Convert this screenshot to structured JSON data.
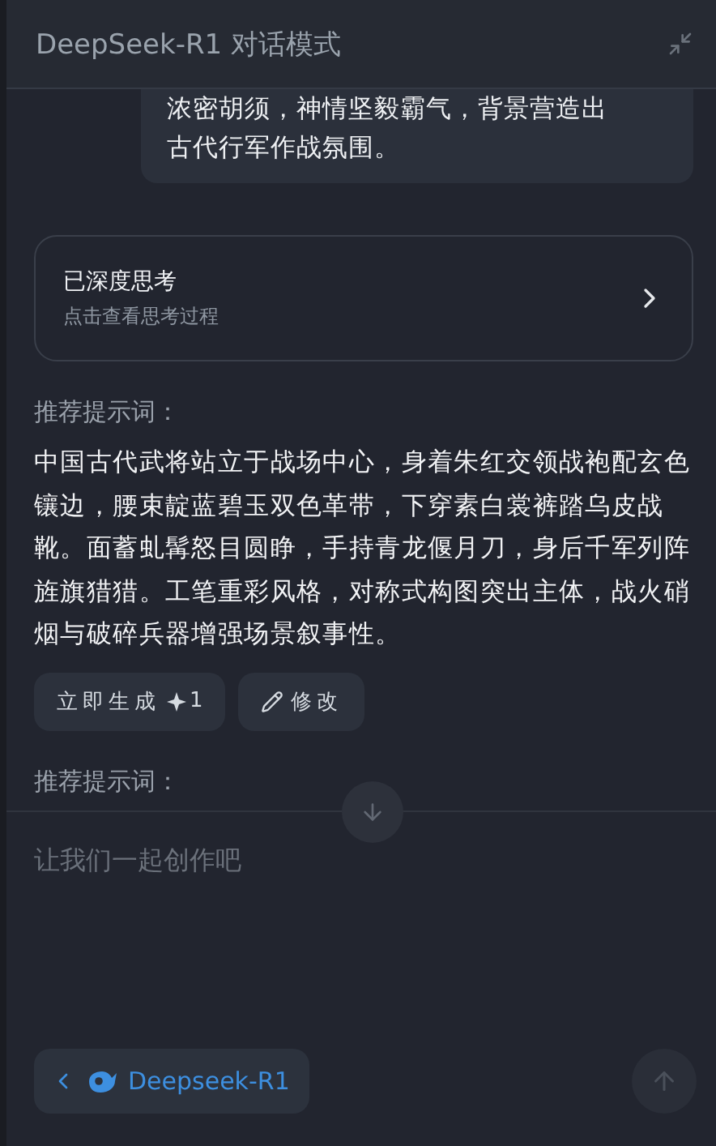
{
  "header": {
    "title": "DeepSeek-R1 对话模式"
  },
  "message": {
    "lines": [
      "浓密胡须，神情坚毅霸气，背景营造出",
      "古代行军作战氛围。"
    ]
  },
  "thinking_card": {
    "title": "已深度思考",
    "subtitle": "点击查看思考过程"
  },
  "suggestion": {
    "label": "推荐提示词：",
    "text": "中国古代武将站立于战场中心，身着朱红交领战袍配玄色镶边，腰束靛蓝碧玉双色革带，下穿素白裳裤踏乌皮战靴。面蓄虬髯怒目圆睁，手持青龙偃月刀，身后千军列阵旌旗猎猎。工笔重彩风格，对称式构图突出主体，战火硝烟与破碎兵器增强场景叙事性。"
  },
  "actions": [
    {
      "kind": "generate",
      "label": "立即生成",
      "cost": "1"
    },
    {
      "kind": "edit",
      "label": "修改"
    }
  ],
  "second_label": "推荐提示词：",
  "input": {
    "placeholder": "让我们一起创作吧"
  },
  "model_button": {
    "label": "Deepseek-R1"
  }
}
